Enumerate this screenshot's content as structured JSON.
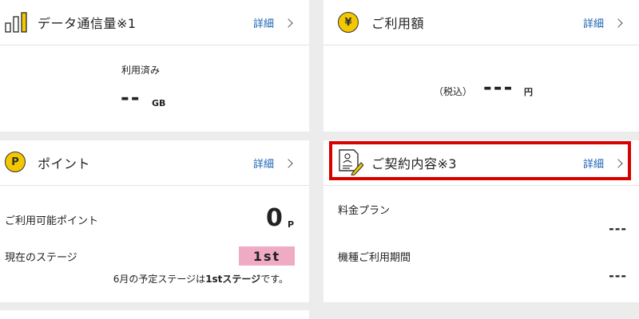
{
  "data_usage": {
    "title": "データ通信量※1",
    "detail_label": "詳細",
    "used_label": "利用済み",
    "value": "--",
    "unit": "GB"
  },
  "charges": {
    "title": "ご利用額",
    "detail_label": "詳細",
    "tax_label": "（税込）",
    "value": "---",
    "unit": "円",
    "icon_symbol": "¥"
  },
  "points": {
    "title": "ポイント",
    "detail_label": "詳細",
    "icon_symbol": "P",
    "available_label": "ご利用可能ポイント",
    "available_value": "0",
    "available_unit": "P",
    "stage_label": "現在のステージ",
    "stage_value": "1st",
    "forecast_prefix": "6月の予定ステージは",
    "forecast_stage": "1stステージ",
    "forecast_suffix": "です。"
  },
  "contract": {
    "title": "ご契約内容※3",
    "detail_label": "詳細",
    "plan_label": "料金プラン",
    "plan_value": "---",
    "period_label": "機種ご利用期間",
    "period_value": "---"
  },
  "colors": {
    "accent_link": "#1a63b3",
    "coin_yellow": "#f3c800",
    "stage_pink": "#efabc4",
    "highlight_red": "#d90000"
  }
}
